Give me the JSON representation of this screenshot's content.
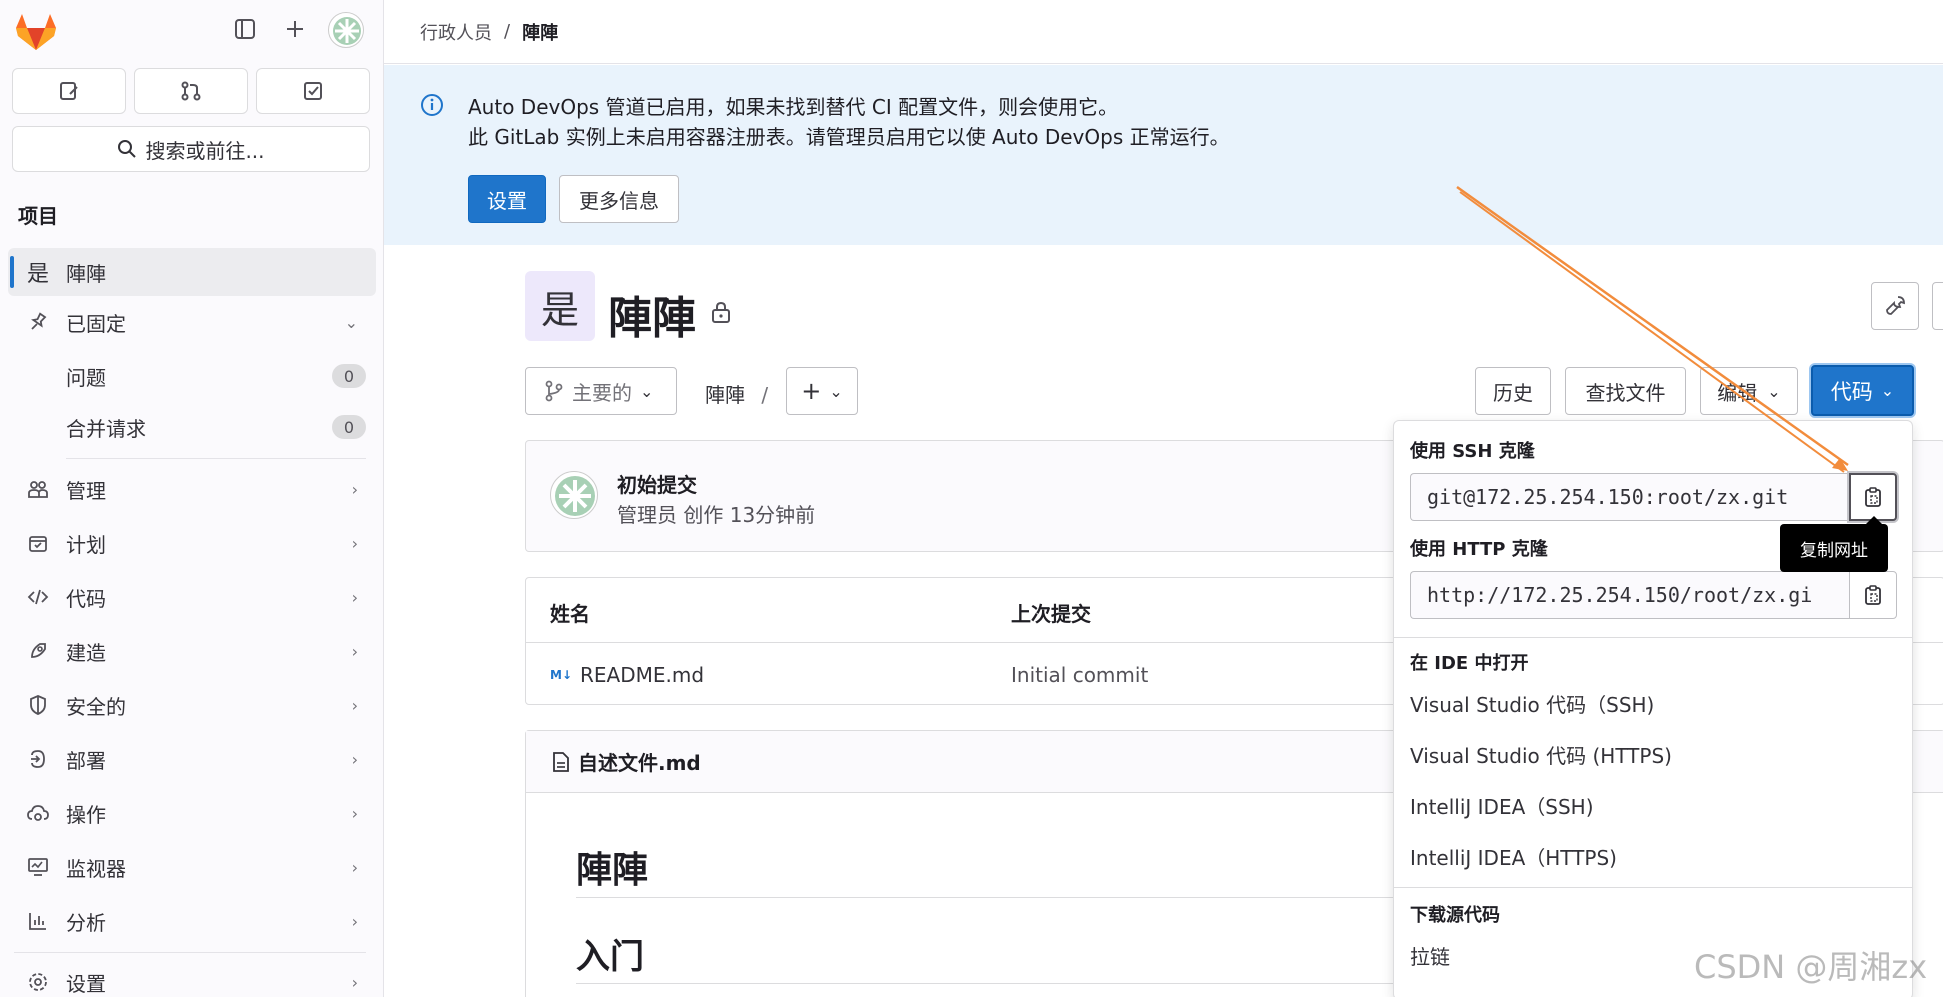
{
  "sidebar": {
    "search_label": "搜索或前往...",
    "section_label": "项目",
    "project": {
      "avatar_letter": "是",
      "name": "陣陣"
    },
    "pinned": {
      "label": "已固定",
      "items": [
        {
          "label": "问题",
          "count": "0"
        },
        {
          "label": "合并请求",
          "count": "0"
        }
      ]
    },
    "nav": [
      {
        "label": "管理"
      },
      {
        "label": "计划"
      },
      {
        "label": "代码"
      },
      {
        "label": "建造"
      },
      {
        "label": "安全的"
      },
      {
        "label": "部署"
      },
      {
        "label": "操作"
      },
      {
        "label": "监视器"
      },
      {
        "label": "分析"
      },
      {
        "label": "设置"
      }
    ]
  },
  "breadcrumb": {
    "parent": "行政人员",
    "separator": "/",
    "current": "陣陣"
  },
  "alert": {
    "line1": "Auto DevOps 管道已启用，如果未找到替代 CI 配置文件，则会使用它。",
    "line2": "此 GitLab 实例上未启用容器注册表。请管理员启用它以使 Auto DevOps 正常运行。",
    "primary_button": "设置",
    "secondary_button": "更多信息"
  },
  "project": {
    "avatar_letter": "是",
    "title": "陣陣"
  },
  "toolbar": {
    "branch": "主要的",
    "path": "陣陣",
    "path_separator": "/",
    "add": "+",
    "history": "历史",
    "find_file": "查找文件",
    "edit": "编辑",
    "code": "代码"
  },
  "commit": {
    "title": "初始提交",
    "author": "管理员",
    "meta": "创作 13分钟前"
  },
  "files": {
    "headers": [
      "姓名",
      "上次提交"
    ],
    "rows": [
      {
        "name": "README.md",
        "commit": "Initial commit"
      }
    ]
  },
  "readme": {
    "filename": "自述文件.md",
    "h1": "陣陣",
    "h2": "入门"
  },
  "clone_dropdown": {
    "ssh_label": "使用 SSH 克隆",
    "ssh_url": "git@172.25.254.150:root/zx.git",
    "http_label": "使用 HTTP 克隆",
    "http_url": "http://172.25.254.150/root/zx.gi",
    "ide_label": "在 IDE 中打开",
    "ide_items": [
      "Visual Studio 代码（SSH)",
      "Visual Studio 代码 (HTTPS)",
      "IntelliJ IDEA（SSH)",
      "IntelliJ IDEA（HTTPS)"
    ],
    "download_label": "下载源代码",
    "download_items": [
      "拉链"
    ],
    "copy_tooltip": "复制网址"
  },
  "watermark": "CSDN @周湘zx",
  "colors": {
    "primary": "#1f75cb",
    "alert_bg": "#e9f3fc",
    "arrow": "#f28c3c",
    "sidebar_bg": "#fbfafd"
  }
}
